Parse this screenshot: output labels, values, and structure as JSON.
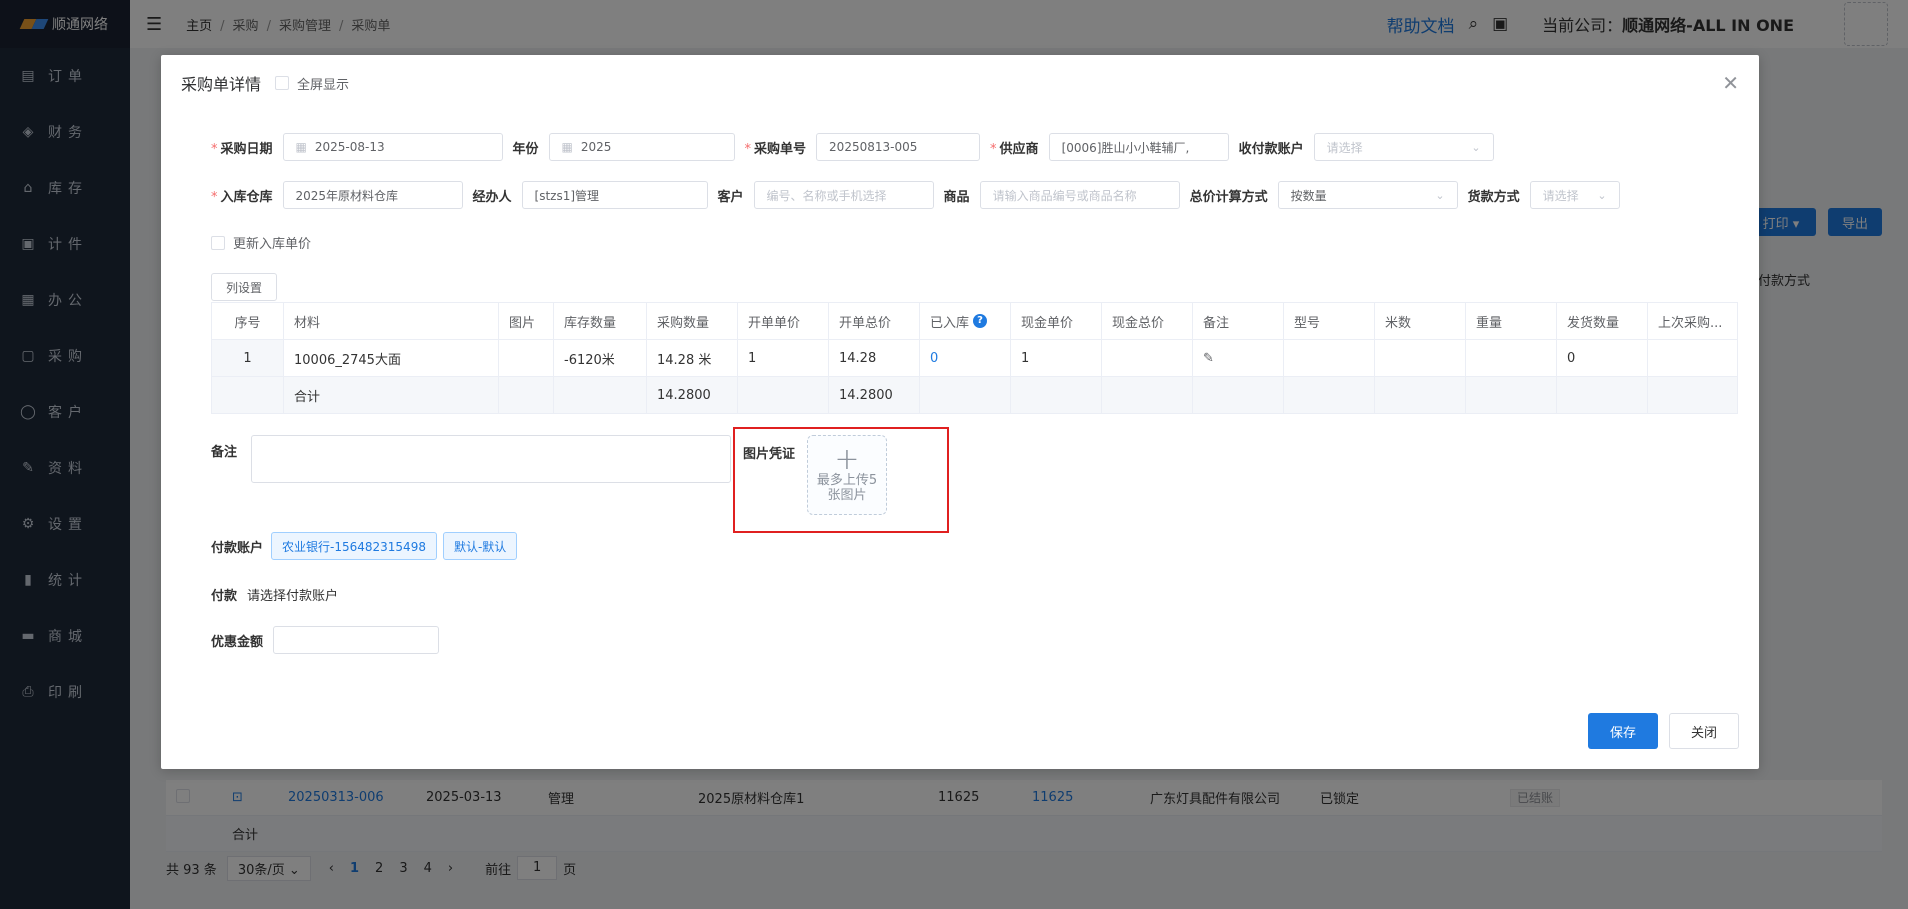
{
  "app": {
    "brand": "顺通网络"
  },
  "sidebar": {
    "items": [
      {
        "label": "订单",
        "icon": "document-icon"
      },
      {
        "label": "财务",
        "icon": "bag-icon"
      },
      {
        "label": "库存",
        "icon": "home-icon"
      },
      {
        "label": "计件",
        "icon": "clipboard-icon"
      },
      {
        "label": "办公",
        "icon": "calendar-icon"
      },
      {
        "label": "采购",
        "icon": "gift-icon"
      },
      {
        "label": "客户",
        "icon": "user-icon"
      },
      {
        "label": "资料",
        "icon": "edit-icon"
      },
      {
        "label": "设置",
        "icon": "gear-icon"
      },
      {
        "label": "统计",
        "icon": "bar-chart-icon"
      },
      {
        "label": "商城",
        "icon": "shop-icon"
      },
      {
        "label": "印刷",
        "icon": "printer-icon"
      }
    ]
  },
  "header": {
    "breadcrumb": [
      "主页",
      "采购",
      "采购管理",
      "采购单"
    ],
    "help": "帮助文档",
    "company_prefix": "当前公司：",
    "company_name": "顺通网络-ALL IN ONE"
  },
  "background": {
    "print_btn": "打印 ▾",
    "export_btn": "导出",
    "payment_col": "付款方式",
    "row": {
      "order_no": "20250313-006",
      "date": "2025-03-13",
      "handler": "管理",
      "warehouse": "2025原材料仓库1",
      "amount1": "11625",
      "amount2": "11625",
      "supplier": "广东灯具配件有限公司",
      "status": "已锁定",
      "settle": "已结账"
    },
    "sum_label": "合计",
    "pager": {
      "total": "共 93 条",
      "page_size": "30条/页",
      "pages": [
        "1",
        "2",
        "3",
        "4"
      ],
      "goto_prefix": "前往",
      "goto_value": "1",
      "goto_suffix": "页"
    }
  },
  "dialog": {
    "title": "采购单详情",
    "fullscreen_label": "全屏显示",
    "row1": {
      "date_label": "采购日期",
      "date_value": "2025-08-13",
      "year_label": "年份",
      "year_value": "2025",
      "order_no_label": "采购单号",
      "order_no_value": "20250813-005",
      "supplier_label": "供应商",
      "supplier_value": "[0006]胜山小小鞋辅厂,",
      "account_label": "收付款账户",
      "account_placeholder": "请选择"
    },
    "row2": {
      "warehouse_label": "入库仓库",
      "warehouse_value": "2025年原材料仓库",
      "handler_label": "经办人",
      "handler_value": "[stzs1]管理",
      "customer_label": "客户",
      "customer_placeholder": "编号、名称或手机选择",
      "product_label": "商品",
      "product_placeholder": "请输入商品编号或商品名称",
      "calc_label": "总价计算方式",
      "calc_value": "按数量",
      "payment_method_label": "货款方式",
      "payment_method_placeholder": "请选择"
    },
    "update_price_label": "更新入库单价",
    "column_settings": "列设置",
    "table": {
      "headers": [
        "序号",
        "材料",
        "图片",
        "库存数量",
        "采购数量",
        "开单单价",
        "开单总价",
        "已入库",
        "现金单价",
        "现金总价",
        "备注",
        "型号",
        "米数",
        "重量",
        "发货数量",
        "上次采购..."
      ],
      "row": [
        "1",
        "10006_2745大面",
        "",
        "-6120米",
        "14.28 米",
        "1",
        "14.28",
        "0",
        "1",
        "",
        "",
        "",
        "",
        "",
        "0",
        ""
      ],
      "sum": [
        "",
        "合计",
        "",
        "",
        "14.2800",
        "",
        "14.2800",
        "",
        "",
        "",
        "",
        "",
        "",
        "",
        "",
        ""
      ]
    },
    "remark_label": "备注",
    "image_label": "图片凭证",
    "upload_text": "最多上传5张图片",
    "pay_account_label": "付款账户",
    "pay_account_tags": [
      "农业银行-156482315498",
      "默认-默认"
    ],
    "pay_label": "付款",
    "pay_value": "请选择付款账户",
    "discount_label": "优惠金额",
    "save_btn": "保存",
    "close_btn": "关闭"
  }
}
